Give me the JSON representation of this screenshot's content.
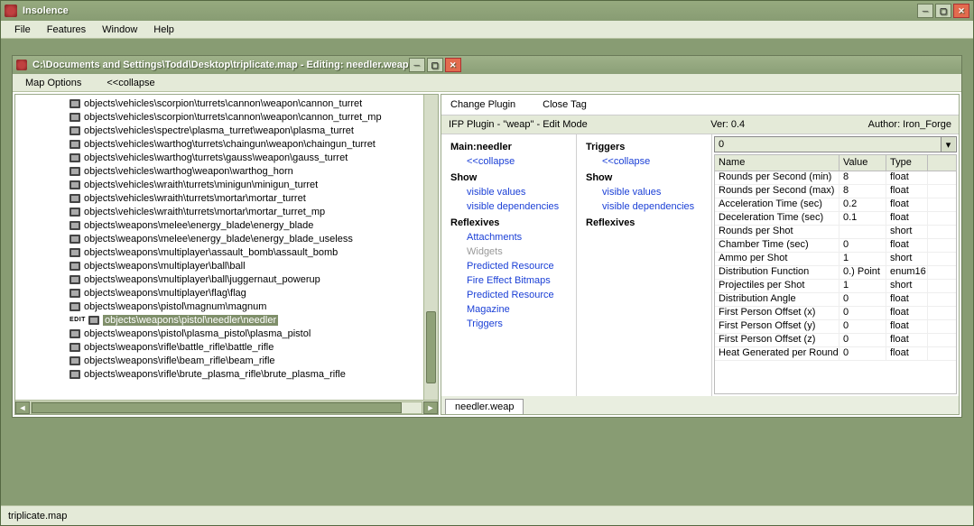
{
  "app": {
    "title": "Insolence"
  },
  "menu": [
    "File",
    "Features",
    "Window",
    "Help"
  ],
  "doc": {
    "title": "C:\\Documents and Settings\\Todd\\Desktop\\triplicate.map - Editing: needler.weap",
    "toolbar": {
      "map_options": "Map Options",
      "collapse": "<<collapse"
    }
  },
  "tree": {
    "selected_index": 17,
    "items": [
      "objects\\vehicles\\scorpion\\turrets\\cannon\\weapon\\cannon_turret",
      "objects\\vehicles\\scorpion\\turrets\\cannon\\weapon\\cannon_turret_mp",
      "objects\\vehicles\\spectre\\plasma_turret\\weapon\\plasma_turret",
      "objects\\vehicles\\warthog\\turrets\\chaingun\\weapon\\chaingun_turret",
      "objects\\vehicles\\warthog\\turrets\\gauss\\weapon\\gauss_turret",
      "objects\\vehicles\\warthog\\weapon\\warthog_horn",
      "objects\\vehicles\\wraith\\turrets\\minigun\\minigun_turret",
      "objects\\vehicles\\wraith\\turrets\\mortar\\mortar_turret",
      "objects\\vehicles\\wraith\\turrets\\mortar\\mortar_turret_mp",
      "objects\\weapons\\melee\\energy_blade\\energy_blade",
      "objects\\weapons\\melee\\energy_blade\\energy_blade_useless",
      "objects\\weapons\\multiplayer\\assault_bomb\\assault_bomb",
      "objects\\weapons\\multiplayer\\ball\\ball",
      "objects\\weapons\\multiplayer\\ball\\juggernaut_powerup",
      "objects\\weapons\\multiplayer\\flag\\flag",
      "objects\\weapons\\pistol\\magnum\\magnum",
      "objects\\weapons\\pistol\\needler\\needler",
      "objects\\weapons\\pistol\\plasma_pistol\\plasma_pistol",
      "objects\\weapons\\rifle\\battle_rifle\\battle_rifle",
      "objects\\weapons\\rifle\\beam_rifle\\beam_rifle",
      "objects\\weapons\\rifle\\brute_plasma_rifle\\brute_plasma_rifle"
    ]
  },
  "right": {
    "buttons": {
      "change_plugin": "Change Plugin",
      "close_tag": "Close Tag"
    },
    "info": {
      "plugin": "IFP Plugin - \"weap\" - Edit Mode",
      "ver": "Ver: 0.4",
      "author": "Author: Iron_Forge"
    },
    "main": {
      "title": "Main:needler",
      "collapse": "<<collapse",
      "show": "Show",
      "visible_values": "visible values",
      "visible_deps": "visible dependencies",
      "reflexives_h": "Reflexives",
      "reflexives": [
        "Attachments",
        "Widgets",
        "Predicted Resource",
        "Fire Effect Bitmaps",
        "Predicted Resource",
        "Magazine",
        "Triggers"
      ],
      "gray_index": 1
    },
    "trig": {
      "title": "Triggers",
      "collapse": "<<collapse",
      "show": "Show",
      "visible_values": "visible values",
      "visible_deps": "visible dependencies",
      "reflexives_h": "Reflexives"
    },
    "dropdown": "0",
    "headers": {
      "name": "Name",
      "value": "Value",
      "type": "Type"
    },
    "rows": [
      {
        "n": "Rounds per Second (min)",
        "v": "8",
        "t": "float"
      },
      {
        "n": "Rounds per Second (max)",
        "v": "8",
        "t": "float"
      },
      {
        "n": "Acceleration Time (sec)",
        "v": "0.2",
        "t": "float"
      },
      {
        "n": "Deceleration Time (sec)",
        "v": "0.1",
        "t": "float"
      },
      {
        "n": "Rounds per Shot",
        "v": "",
        "t": "short"
      },
      {
        "n": "Chamber Time (sec)",
        "v": "0",
        "t": "float"
      },
      {
        "n": "Ammo per Shot",
        "v": "1",
        "t": "short"
      },
      {
        "n": "Distribution Function",
        "v": "0.) Point",
        "t": "enum16"
      },
      {
        "n": "Projectiles per Shot",
        "v": "1",
        "t": "short"
      },
      {
        "n": "Distribution Angle",
        "v": "0",
        "t": "float"
      },
      {
        "n": "First Person Offset (x)",
        "v": "0",
        "t": "float"
      },
      {
        "n": "First Person Offset (y)",
        "v": "0",
        "t": "float"
      },
      {
        "n": "First Person Offset (z)",
        "v": "0",
        "t": "float"
      },
      {
        "n": "Heat Generated per Round",
        "v": "0",
        "t": "float"
      }
    ],
    "tab": "needler.weap"
  },
  "status": "triplicate.map"
}
